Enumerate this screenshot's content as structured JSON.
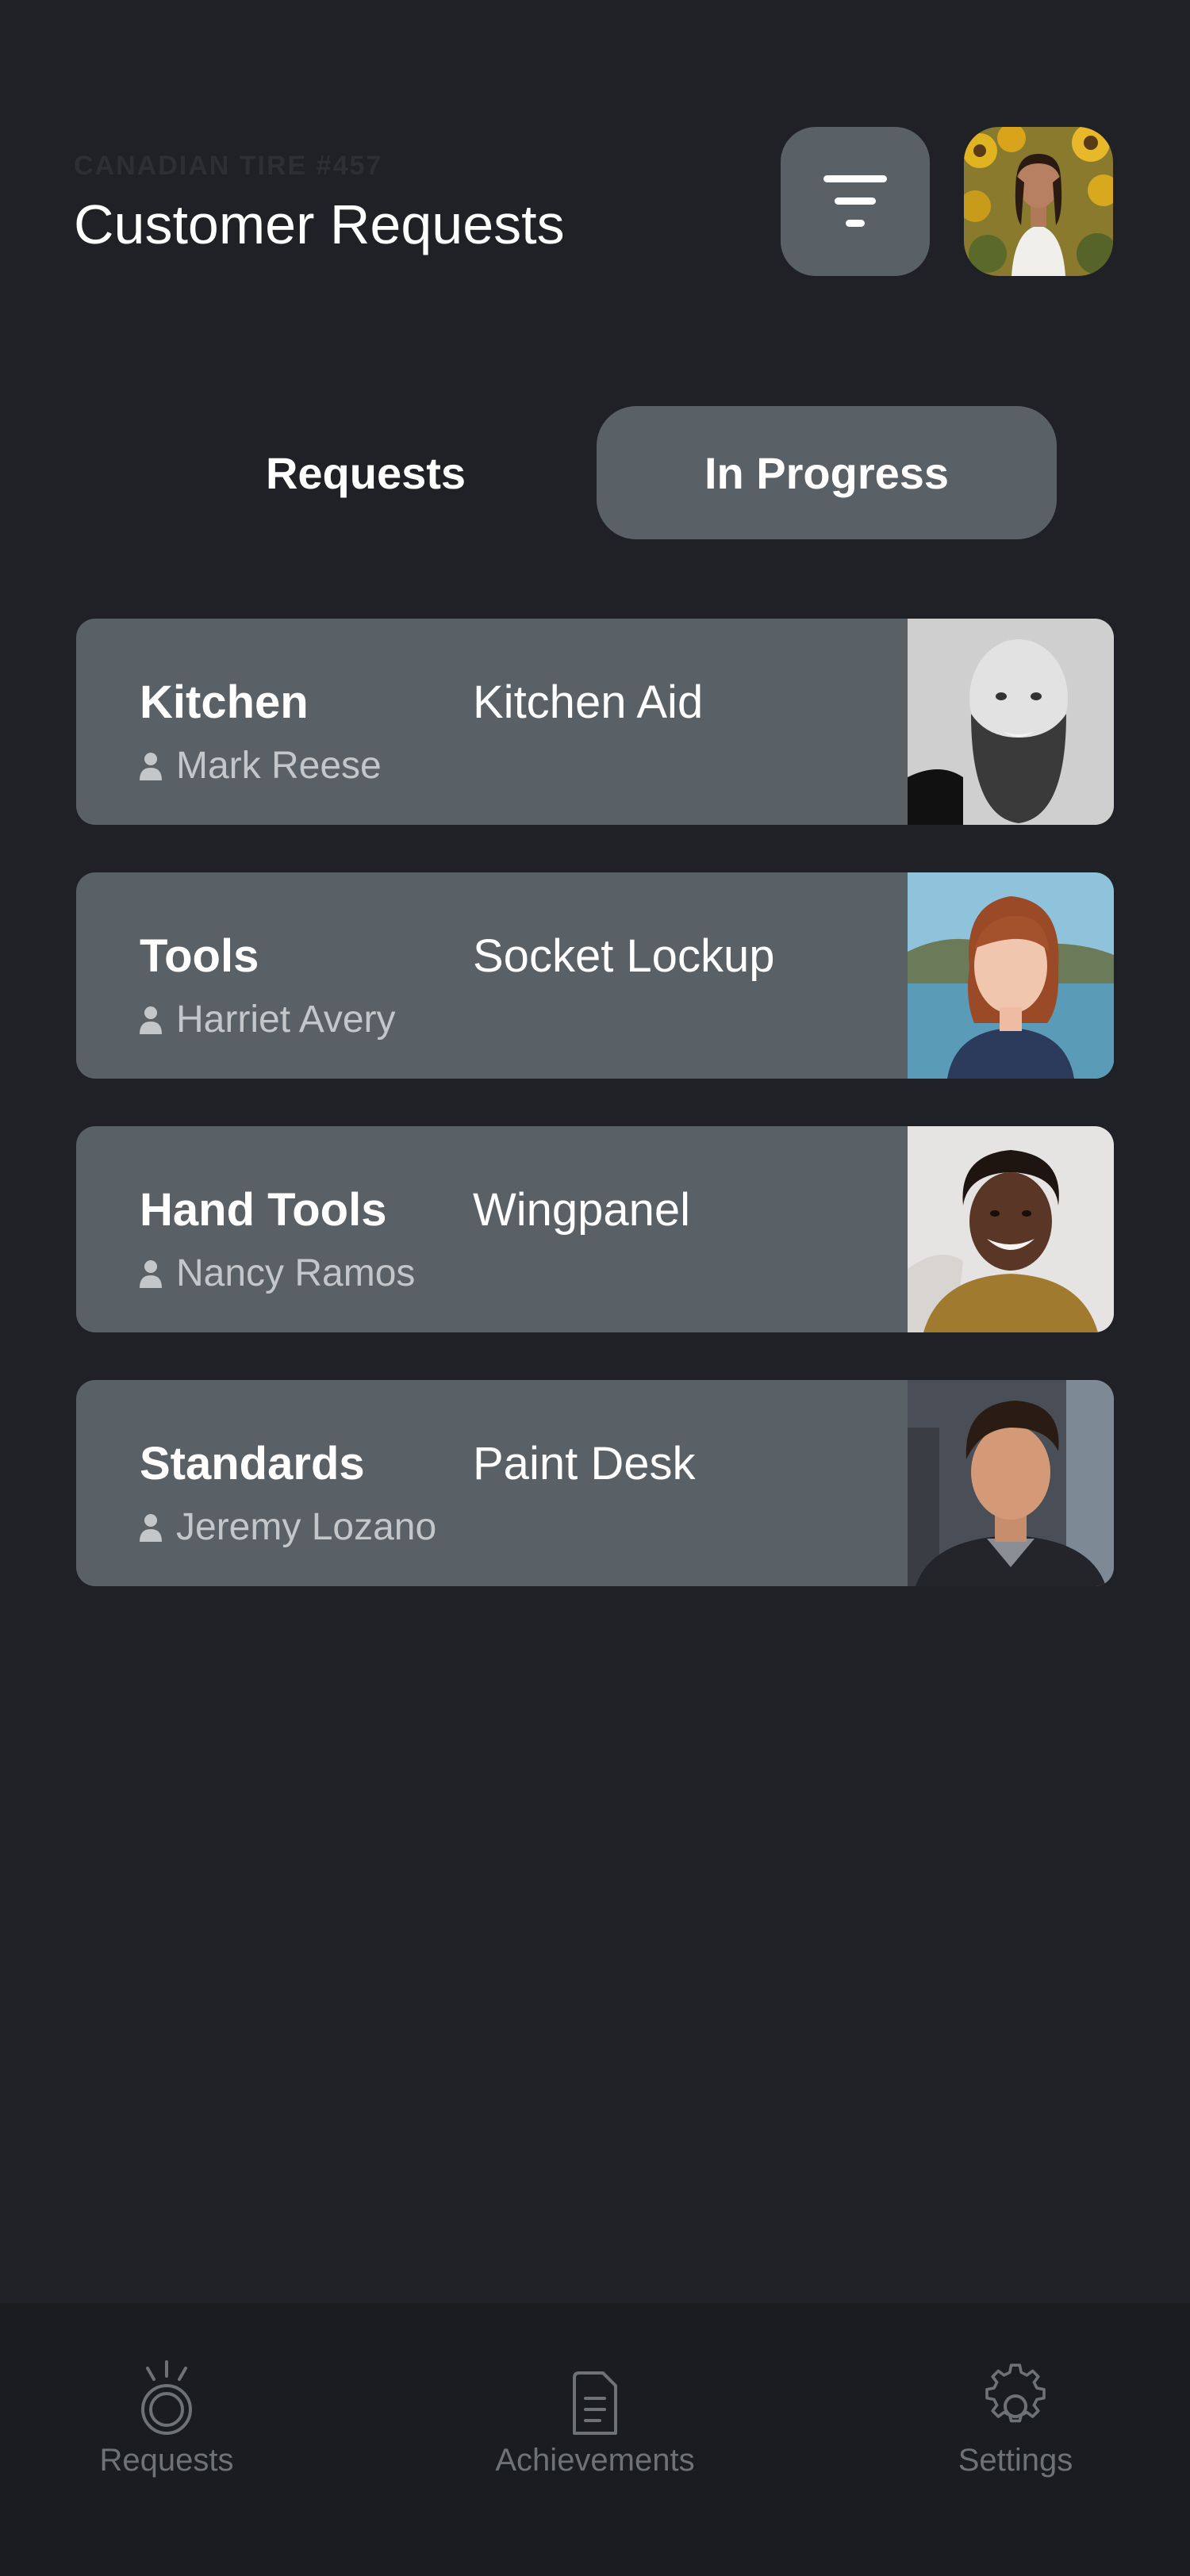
{
  "header": {
    "store": "CANADIAN TIRE #457",
    "title": "Customer Requests"
  },
  "tabs": [
    {
      "label": "Requests",
      "active": false
    },
    {
      "label": "In Progress",
      "active": true
    }
  ],
  "requests": [
    {
      "department": "Kitchen",
      "item": "Kitchen Aid",
      "customer": "Mark Reese"
    },
    {
      "department": "Tools",
      "item": "Socket Lockup",
      "customer": "Harriet Avery"
    },
    {
      "department": "Hand Tools",
      "item": "Wingpanel",
      "customer": "Nancy Ramos"
    },
    {
      "department": "Standards",
      "item": "Paint Desk",
      "customer": "Jeremy Lozano"
    }
  ],
  "nav": [
    {
      "label": "Requests",
      "icon": "requests-icon"
    },
    {
      "label": "Achievements",
      "icon": "document-icon"
    },
    {
      "label": "Settings",
      "icon": "gear-icon"
    }
  ],
  "colors": {
    "background": "#202126",
    "card": "#5a6166",
    "nav_background": "#1b1c20",
    "nav_text": "#6e7277",
    "secondary_text": "#c4c7ca"
  }
}
